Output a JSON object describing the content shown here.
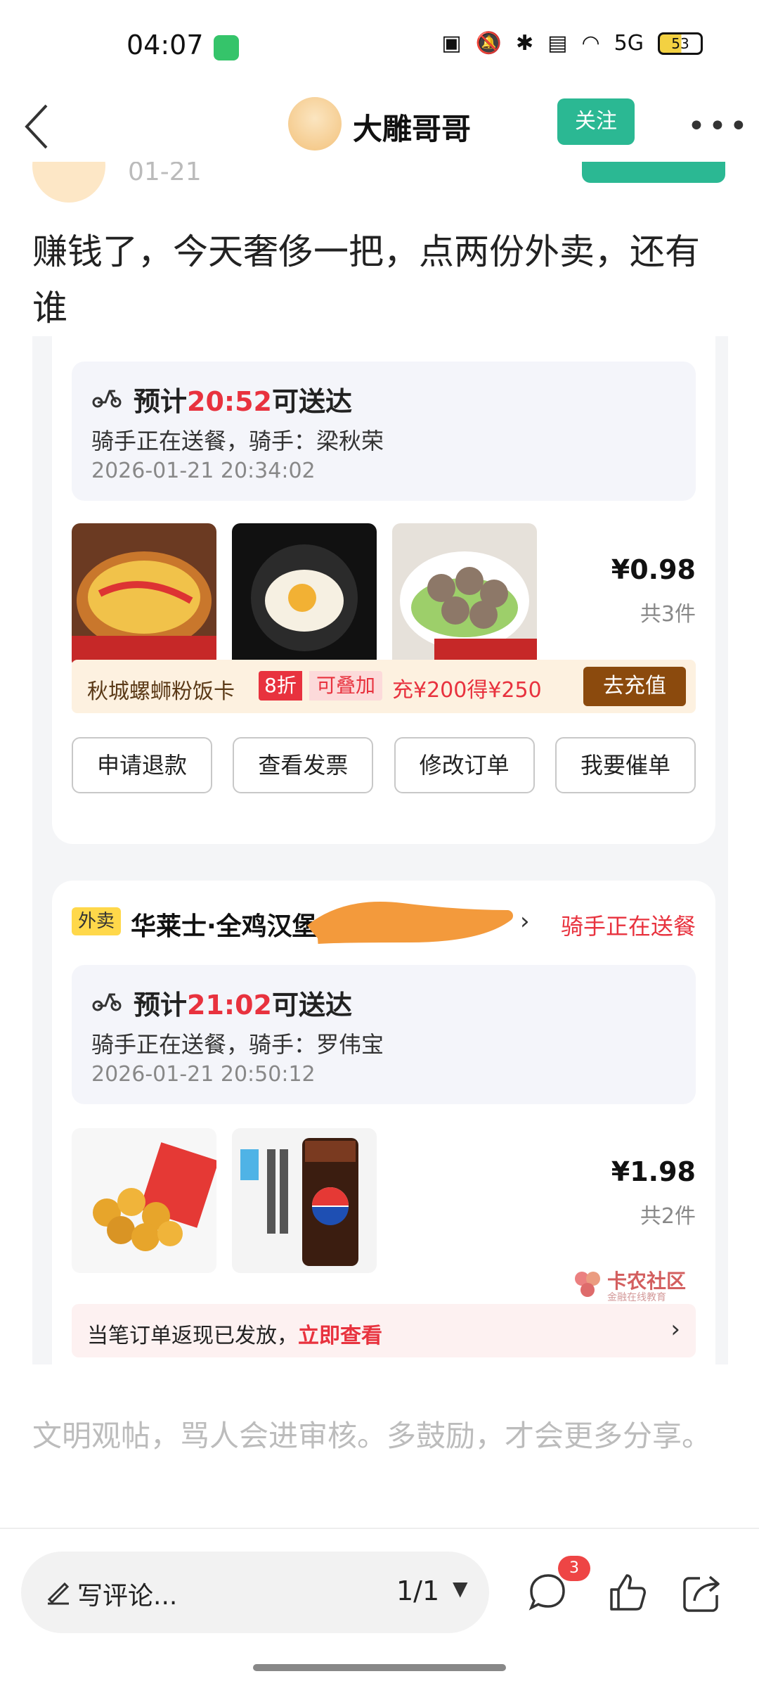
{
  "status_bar": {
    "time": "04:07",
    "battery": "53",
    "network": "5G"
  },
  "header": {
    "name": "大雕哥哥",
    "follow_label": "关注"
  },
  "author": {
    "date": "01-21"
  },
  "post": {
    "text": "赚钱了，今天奢侈一把，点两份外卖，还有谁"
  },
  "order1": {
    "eta_prefix": "预计",
    "eta_time": "20:52",
    "eta_suffix": "可送达",
    "rider_text": "骑手正在送餐，骑手：梁秋荣",
    "timestamp": "2026-01-21 20:34:02",
    "price": "¥0.98",
    "count": "共3件",
    "promo": {
      "card_name": "秋城螺蛳粉饭卡",
      "discount": "8折",
      "stackable": "可叠加",
      "offer": "充¥200得¥250",
      "button": "去充值"
    },
    "actions": [
      "申请退款",
      "查看发票",
      "修改订单",
      "我要催单"
    ]
  },
  "order2": {
    "tag": "外卖",
    "store": "华莱士·全鸡汉堡",
    "status": "骑手正在送餐",
    "eta_prefix": "预计",
    "eta_time": "21:02",
    "eta_suffix": "可送达",
    "rider_text": "骑手正在送餐，骑手：罗伟宝",
    "timestamp": "2026-01-21 20:50:12",
    "price": "¥1.98",
    "count": "共2件",
    "cashback_text": "当笔订单返现已发放，",
    "cashback_link": "立即查看"
  },
  "watermark": {
    "text": "卡农社区",
    "sub": "金融在线教育"
  },
  "hint": "文明观帖，骂人会进审核。多鼓励，才会更多分享。",
  "bottom_bar": {
    "comment_placeholder": "写评论...",
    "page": "1/1",
    "comment_count": "3"
  },
  "colors": {
    "accent_green": "#2bb893",
    "price_red": "#e8323e"
  }
}
